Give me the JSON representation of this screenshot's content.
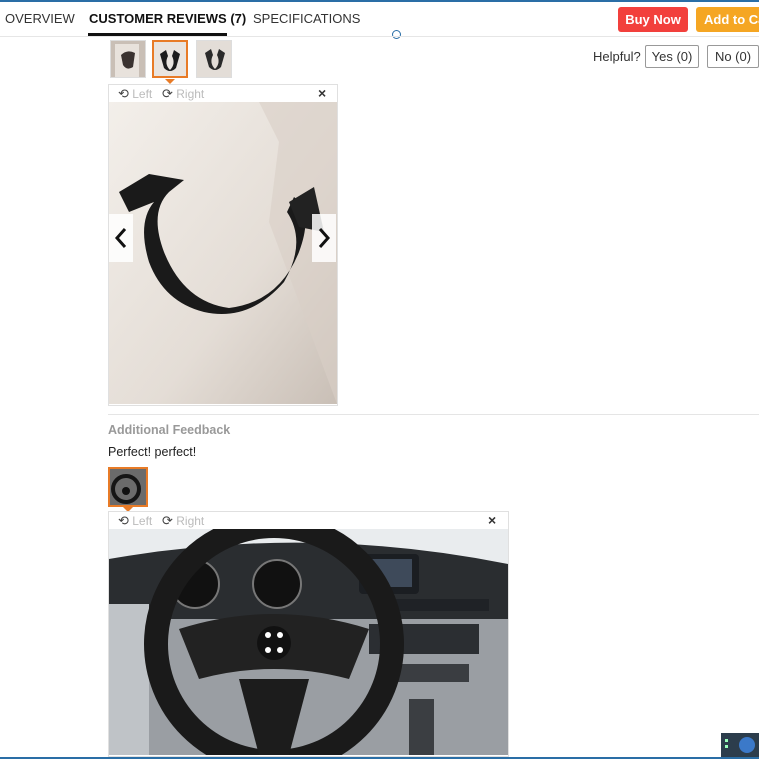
{
  "tabs": [
    {
      "label": "OVERVIEW",
      "active": false
    },
    {
      "label": "CUSTOMER REVIEWS (7)",
      "active": true
    },
    {
      "label": "SPECIFICATIONS",
      "active": false
    }
  ],
  "actions": {
    "buy_now": "Buy Now",
    "add_to_cart": "Add to Ca"
  },
  "helpful": {
    "label": "Helpful?",
    "yes": "Yes (0)",
    "no": "No (0)"
  },
  "viewer": {
    "rotate_left": "Left",
    "rotate_right": "Right",
    "close": "×"
  },
  "additional_feedback": {
    "title": "Additional Feedback",
    "text": "Perfect! perfect!"
  },
  "colors": {
    "buy": "#f2403c",
    "cart": "#f5a623",
    "selected_thumb": "#e87b27"
  },
  "icons": [
    "rotate-left-icon",
    "rotate-right-icon",
    "close-icon",
    "chevron-left-icon",
    "chevron-right-icon"
  ]
}
